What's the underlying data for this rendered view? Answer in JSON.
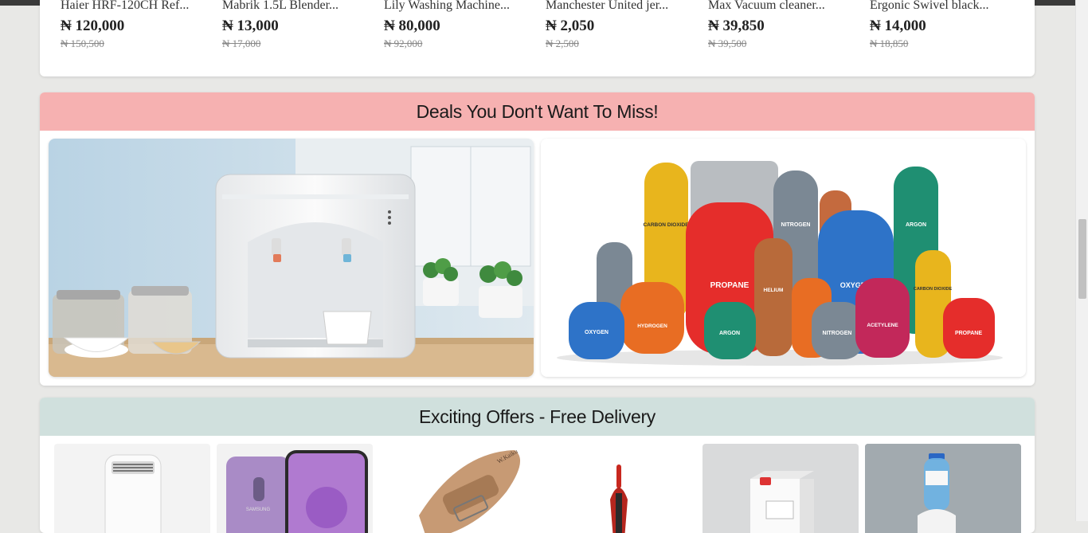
{
  "currency_symbol": "₦",
  "product_strip": [
    {
      "name": "Haier HRF-120CH Ref...",
      "price": "₦ 120,000",
      "old_price": "₦ 150,500"
    },
    {
      "name": "Mabrik 1.5L Blender...",
      "price": "₦ 13,000",
      "old_price": "₦ 17,000"
    },
    {
      "name": "Lily Washing Machine...",
      "price": "₦ 80,000",
      "old_price": "₦ 92,000"
    },
    {
      "name": "Manchester United jer...",
      "price": "₦ 2,050",
      "old_price": "₦ 2,500"
    },
    {
      "name": "Max Vacuum cleaner...",
      "price": "₦ 39,850",
      "old_price": "₦ 39,500"
    },
    {
      "name": "Ergonic Swivel black...",
      "price": "₦ 14,000",
      "old_price": "₦ 18,850"
    }
  ],
  "deals_section": {
    "title": "Deals You Don't Want To Miss!",
    "header_color": "#f6b1b1",
    "banners": [
      {
        "name": "water-dispenser-banner"
      },
      {
        "name": "gas-cylinders-banner",
        "cylinder_labels": [
          "CARBON DIOXIDE",
          "NITROGEN",
          "ARGON",
          "PROPANE",
          "HELIUM",
          "OXYGEN",
          "HYDROGEN",
          "ARGON",
          "NITROGEN",
          "ACETYLENE",
          "PROPANE",
          "OXYGEN",
          "CARBON DIOXIDE"
        ]
      }
    ]
  },
  "offers_section": {
    "title": "Exciting Offers - Free Delivery",
    "header_color": "#d0e0dd",
    "tiles": [
      {
        "name": "air-conditioner-tile"
      },
      {
        "name": "smartphone-tile",
        "brand_text": "SAMSUNG"
      },
      {
        "name": "sandal-tile",
        "brand_text": "W.Kaiku"
      },
      {
        "name": "vacuum-cleaner-tile"
      },
      {
        "name": "milk-carton-tile"
      },
      {
        "name": "water-bottle-dispenser-tile"
      }
    ]
  },
  "colors": {
    "page_bg": "#e8e8e6",
    "deals_header": "#f6b1b1",
    "offers_header": "#d0e0dd"
  }
}
